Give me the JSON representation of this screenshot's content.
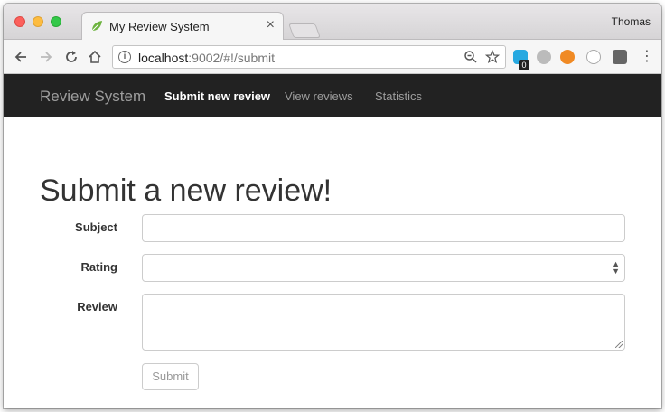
{
  "browser": {
    "tab_title": "My Review System",
    "tab_close": "×",
    "profile_name": "Thomas",
    "url_host": "localhost",
    "url_rest": ":9002/#!/submit",
    "icons": [
      "back-icon",
      "forward-icon",
      "reload-icon",
      "home-icon",
      "info-icon",
      "zoom-icon",
      "star-icon"
    ],
    "extension_badge": "0"
  },
  "navbar": {
    "brand": "Review System",
    "links": [
      {
        "label": "Submit new review",
        "active": true
      },
      {
        "label": "View reviews",
        "active": false
      },
      {
        "label": "Statistics",
        "active": false
      }
    ],
    "background": "#222222"
  },
  "form": {
    "title": "Submit a new review!",
    "subject_label": "Subject",
    "subject_value": "",
    "rating_label": "Rating",
    "rating_value": "",
    "review_label": "Review",
    "review_value": "",
    "submit_label": "Submit"
  }
}
